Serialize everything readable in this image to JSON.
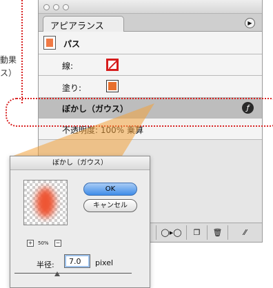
{
  "side_text": [
    "動果",
    "ス）"
  ],
  "panel": {
    "tab_label": "アピアランス",
    "menu_icon": "triangle-menu-icon",
    "rows": {
      "path": "パス",
      "stroke": "線:",
      "fill": "塗り:",
      "blur": "ぼかし（ガウス）",
      "opacity": "不透明度: 100% 乗算"
    },
    "fx_icon_label": "ƒ",
    "bottom_icons": [
      "new-art-icon",
      "duplicate-icon",
      "trash-icon"
    ]
  },
  "dialog": {
    "title": "ぼかし（ガウス）",
    "ok_label": "OK",
    "cancel_label": "キャンセル",
    "zoom_level": "50%",
    "zoom_in_label": "+",
    "zoom_out_label": "−",
    "radius_label": "半径:",
    "radius_value": "7.0",
    "radius_unit": "pixel"
  },
  "colors": {
    "highlight_red": "#d81f1f",
    "callout_orange": "#f0a030",
    "fill_orange": "#e8702e",
    "ok_blue": "#3f8ce8"
  }
}
